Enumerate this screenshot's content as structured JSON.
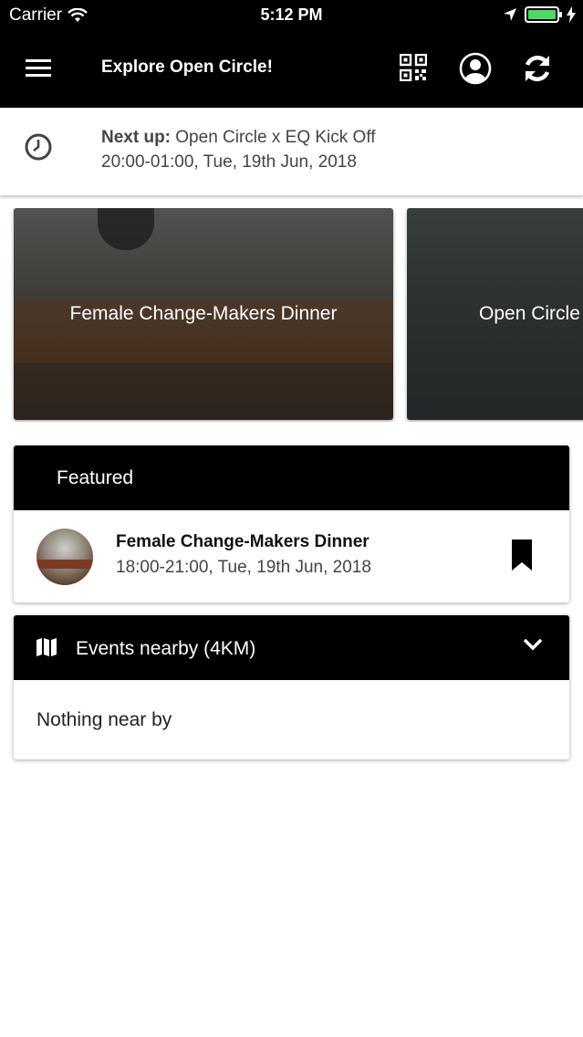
{
  "status_bar": {
    "carrier": "Carrier",
    "time": "5:12 PM",
    "battery_color": "#4cd964"
  },
  "nav": {
    "title": "Explore Open Circle!",
    "icons": [
      "menu-icon",
      "qr-code-icon",
      "user-profile-icon",
      "refresh-icon"
    ]
  },
  "next_up": {
    "label": "Next up:",
    "event": "Open Circle x EQ Kick Off",
    "when": "20:00-01:00, Tue, 19th Jun, 2018"
  },
  "carousel": {
    "slides": [
      {
        "title": "Female Change-Makers Dinner"
      },
      {
        "title": "Open Circle"
      }
    ]
  },
  "featured": {
    "heading": "Featured",
    "event": {
      "title": "Female Change-Makers Dinner",
      "time": "18:00-21:00, Tue, 19th Jun, 2018"
    }
  },
  "nearby": {
    "heading": "Events nearby (4KM)",
    "empty_text": "Nothing near by"
  }
}
